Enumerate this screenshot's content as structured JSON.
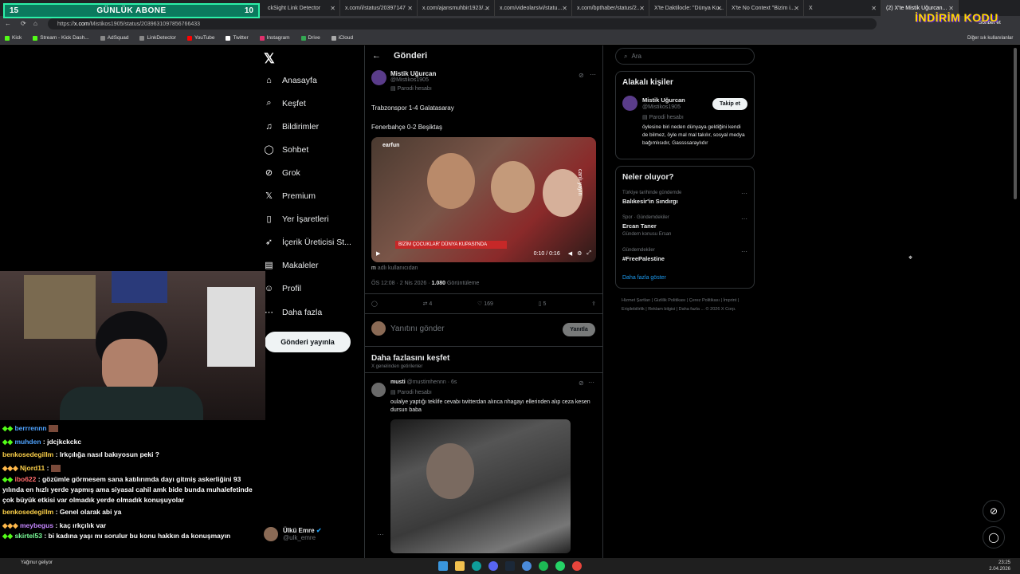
{
  "overlay": {
    "left_num": "15",
    "title": "GÜNLÜK ABONE",
    "right_num": "10"
  },
  "tabs": [
    {
      "label": "ckSight Link Detector"
    },
    {
      "label": "x.com/i/status/20397147"
    },
    {
      "label": "x.com/ajansmuhbir1923/..."
    },
    {
      "label": "x.com/videolarsivi/statu..."
    },
    {
      "label": "x.com/bpthaber/status/2..."
    },
    {
      "label": "X'te Daktilocle: \"Dünya Ku..."
    },
    {
      "label": "X'te No Context \"Bizim i..."
    },
    {
      "label": "X"
    },
    {
      "label": "(2) X'te Mistik Uğurcan..."
    }
  ],
  "url_prefix": "https://",
  "url_host": "x.com",
  "url_path": "/Mistikos1905/status/2039631097856766433",
  "bookmarks": [
    "Kick",
    "Stream - Kick Dash...",
    "AdSquad",
    "LinkDetector",
    "YouTube",
    "Twitter",
    "Instagram",
    "Drive",
    "iCloud"
  ],
  "bookmarks_right": "Diğer sık kullanılanlar",
  "header_right": "Sohbet et",
  "brand_logo": "İNDİRİM KODU",
  "nav": [
    {
      "label": "Anasayfa",
      "icon": "home-icon"
    },
    {
      "label": "Keşfet",
      "icon": "search-icon"
    },
    {
      "label": "Bildirimler",
      "icon": "bell-icon"
    },
    {
      "label": "Sohbet",
      "icon": "chat-icon"
    },
    {
      "label": "Grok",
      "icon": "grok-icon"
    },
    {
      "label": "Premium",
      "icon": "x-premium-icon"
    },
    {
      "label": "Yer İşaretleri",
      "icon": "bookmark-icon"
    },
    {
      "label": "İçerik Üreticisi St...",
      "icon": "rocket-icon"
    },
    {
      "label": "Makaleler",
      "icon": "article-icon"
    },
    {
      "label": "Profil",
      "icon": "person-icon"
    },
    {
      "label": "Daha fazla",
      "icon": "more-icon"
    }
  ],
  "post_button": "Gönderi yayınla",
  "me": {
    "name": "Ülkü Emre",
    "handle": "@ulk_emre"
  },
  "page_title": "Gönderi",
  "post": {
    "name": "Mistik Uğurcan",
    "handle": "@Mistikos1905",
    "parody": "Parodi hesabı",
    "line1": "Trabzonspor 1-4 Galatasaray",
    "line2": "Fenerbahçe 0-2 Beşiktaş",
    "video_brand": "earfun",
    "video_banner": "BİZİM ÇOCUKLAR' DÜNYA KUPASI'NDA",
    "video_live": "canlı yayın",
    "video_time": "0:10 / 0:16",
    "users_suffix": "adlı kullanıcıdan",
    "users_prefix": "m",
    "meta": "ÖS 12:08 · 2 Nis 2026 ·",
    "views": "1.080",
    "views_label": "Görüntüleme",
    "reposts": "4",
    "likes": "169",
    "bookmarks": "5"
  },
  "reply_placeholder": "Yanıtını gönder",
  "reply_button": "Yanıtla",
  "explore_title": "Daha fazlasını keşfet",
  "explore_sub": "X genelinden getirilenler",
  "post2": {
    "name": "musti",
    "handle": "@mustimhennn · 6s",
    "parody": "Parodi hesabı",
    "text": "oulalye yaptığı teklife cevabı twitterdan alınca nhagayı ellerinden alıp ceza kesen dursun baba"
  },
  "search_placeholder": "Ara",
  "related": {
    "title": "Alakalı kişiler",
    "name": "Mistik Uğurcan",
    "handle": "@Mistikos1905",
    "parody": "Parodi hesabı",
    "bio": "öylesine biri neden dünyaya geldiğini kendi de bilmez, öyle mal mal takılır, sosyal medya bağımlısıdır, Gassssaraylıdır",
    "follow": "Takip et"
  },
  "trends": {
    "title": "Neler oluyor?",
    "items": [
      {
        "context": "Türkiye tarihinde gündemde",
        "name": "Balıkesir'in Sındırgı",
        "extra": ""
      },
      {
        "context": "Spor · Gündemdekiler",
        "name": "Ercan Taner",
        "extra": "Gündem konusu Ersan"
      },
      {
        "context": "Gündemdekiler",
        "name": "#FreePalestine",
        "extra": ""
      }
    ],
    "more": "Daha fazla göster"
  },
  "footer": "Hizmet Şartları | Gizlilik Politikası | Çerez Politikası | İmprint | Erişilebilirlik | Reklam bilgisi | Daha fazla ... © 2026 X Corp.",
  "chat": [
    {
      "user": "berrrennn",
      "msg": "",
      "cls": "u1"
    },
    {
      "user": "muhden",
      "msg": ": jdcjkckckc",
      "cls": "u1"
    },
    {
      "user": "benkosedegillm",
      "msg": ": Irkçılığa nasıl bakıyosun peki ?",
      "cls": "u2"
    },
    {
      "user": "Njord11",
      "msg": ":",
      "cls": "u2"
    },
    {
      "user": "ibo622",
      "msg": ": gözümle görmesem sana katılırımda dayı gitmiş askerliğini 93 yılında en hızlı yerde yapmış ama siyasal cahil amk bide bunda muhalefetinde çok büyük etkisi var olmadık yerde olmadık konuşuyolar",
      "cls": "u4"
    },
    {
      "user": "benkosedegillm",
      "msg": ": Genel olarak abi ya",
      "cls": "u2"
    },
    {
      "user": "meybegus",
      "msg": ": kaç ırkçılık var",
      "cls": "u3"
    },
    {
      "user": "skirtel53",
      "msg": ": bi kadına yaşı mı sorulur bu konu hakkın da konuşmayın",
      "cls": "u5"
    }
  ],
  "weather": "Yağmur geliyor",
  "clock": {
    "time": "23:25",
    "date": "2.04.2026"
  },
  "colors": {
    "accent": "#1d9bf0",
    "overlay": "#0b7a5e",
    "kick": "#53fc18"
  }
}
